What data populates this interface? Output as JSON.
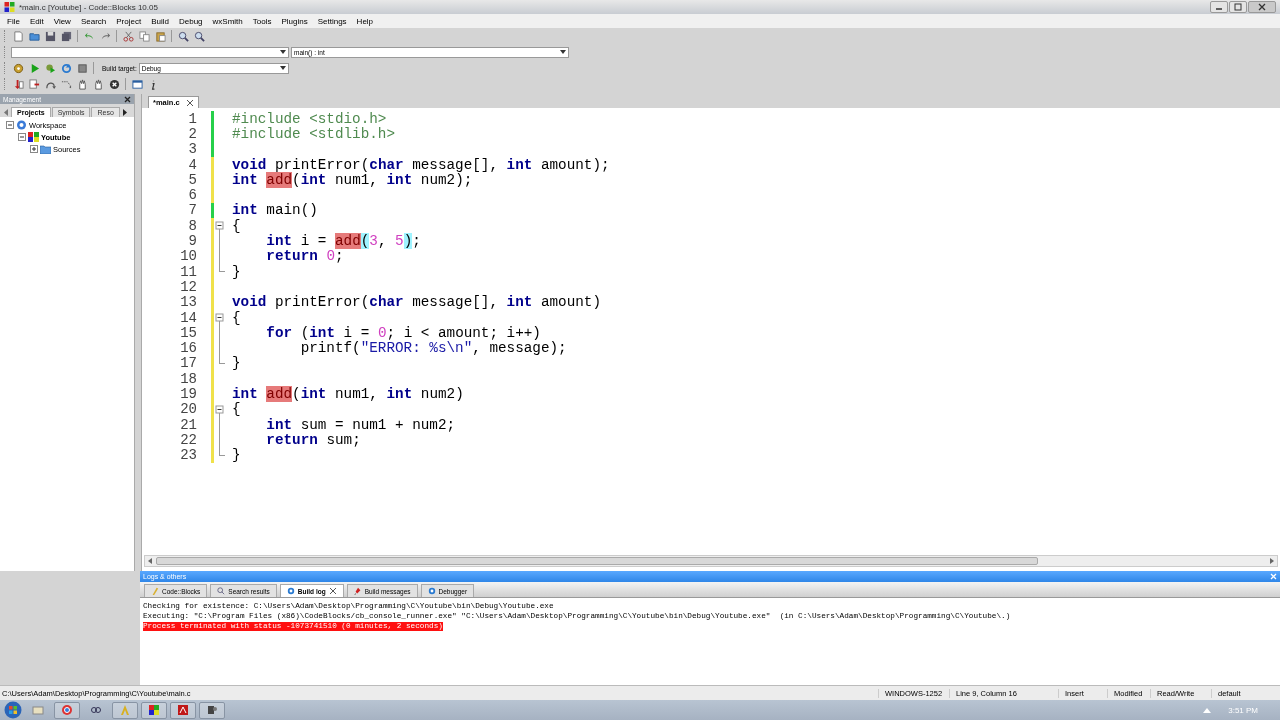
{
  "window": {
    "title": "*main.c [Youtube] - Code::Blocks 10.05"
  },
  "menu": [
    "File",
    "Edit",
    "View",
    "Search",
    "Project",
    "Build",
    "Debug",
    "wxSmith",
    "Tools",
    "Plugins",
    "Settings",
    "Help"
  ],
  "toolbar": {
    "scope_value": "main() : int",
    "build_target_label": "Build target:",
    "build_target": "Debug"
  },
  "management": {
    "title": "Management",
    "tabs": [
      {
        "label": "Projects",
        "selected": true
      },
      {
        "label": "Symbols",
        "selected": false
      },
      {
        "label": "Reso",
        "selected": false
      }
    ],
    "tree": [
      {
        "label": "Workspace",
        "kind": "workspace",
        "expanded": true,
        "active": false,
        "children": [
          {
            "label": "Youtube",
            "kind": "project",
            "expanded": true,
            "active": true,
            "children": [
              {
                "label": "Sources",
                "kind": "folder",
                "expanded": false,
                "active": false
              }
            ]
          }
        ]
      }
    ]
  },
  "editor": {
    "tabs": [
      {
        "label": "*main.c",
        "selected": true
      }
    ],
    "lines": [
      {
        "number": "1",
        "modified": false,
        "tokens": [
          {
            "kind": "pp",
            "text": "#include <stdio.h>"
          }
        ]
      },
      {
        "number": "2",
        "modified": false,
        "tokens": [
          {
            "kind": "pp",
            "text": "#include <stdlib.h>"
          }
        ]
      },
      {
        "number": "3",
        "modified": false
      },
      {
        "number": "4",
        "modified": true,
        "tokens": [
          {
            "kind": "kw",
            "text": "void"
          },
          {
            "kind": "op",
            "text": " printError("
          },
          {
            "kind": "kw",
            "text": "char"
          },
          {
            "kind": "op",
            "text": " message[], "
          },
          {
            "kind": "kw",
            "text": "int"
          },
          {
            "kind": "op",
            "text": " amount);"
          }
        ]
      },
      {
        "number": "5",
        "modified": true,
        "tokens": [
          {
            "kind": "kw",
            "text": "int "
          },
          {
            "kind": "hl",
            "text": "add"
          },
          {
            "kind": "op",
            "text": "("
          },
          {
            "kind": "kw",
            "text": "int"
          },
          {
            "kind": "op",
            "text": " num1, "
          },
          {
            "kind": "kw",
            "text": "int"
          },
          {
            "kind": "op",
            "text": " num2);"
          }
        ]
      },
      {
        "number": "6",
        "modified": true
      },
      {
        "number": "7",
        "modified": false,
        "tokens": [
          {
            "kind": "kw",
            "text": "int"
          },
          {
            "kind": "op",
            "text": " main()"
          }
        ]
      },
      {
        "number": "8",
        "modified": true,
        "kind": "foldstart",
        "tokens": [
          {
            "kind": "op",
            "text": "{"
          }
        ]
      },
      {
        "number": "9",
        "modified": true,
        "kind": "foldbody",
        "tokens": [
          {
            "kind": "kw",
            "text": "    int"
          },
          {
            "kind": "op",
            "text": " i = "
          },
          {
            "kind": "hl",
            "text": "add"
          },
          {
            "kind": "brace",
            "text": "("
          },
          {
            "kind": "num",
            "text": "3"
          },
          {
            "kind": "op",
            "text": ", "
          },
          {
            "kind": "num",
            "text": "5"
          },
          {
            "kind": "brace",
            "text": ")"
          },
          {
            "kind": "op",
            "text": ";"
          }
        ]
      },
      {
        "number": "10",
        "modified": true,
        "kind": "foldbody",
        "tokens": [
          {
            "kind": "kw",
            "text": "    return "
          },
          {
            "kind": "num",
            "text": "0"
          },
          {
            "kind": "op",
            "text": ";"
          }
        ]
      },
      {
        "number": "11",
        "modified": true,
        "kind": "foldend",
        "tokens": [
          {
            "kind": "op",
            "text": "}"
          }
        ]
      },
      {
        "number": "12",
        "modified": true
      },
      {
        "number": "13",
        "modified": true,
        "tokens": [
          {
            "kind": "kw",
            "text": "void"
          },
          {
            "kind": "op",
            "text": " printError("
          },
          {
            "kind": "kw",
            "text": "char"
          },
          {
            "kind": "op",
            "text": " message[], "
          },
          {
            "kind": "kw",
            "text": "int"
          },
          {
            "kind": "op",
            "text": " amount)"
          }
        ]
      },
      {
        "number": "14",
        "modified": true,
        "kind": "foldstart",
        "tokens": [
          {
            "kind": "op",
            "text": "{"
          }
        ]
      },
      {
        "number": "15",
        "modified": true,
        "kind": "foldbody",
        "tokens": [
          {
            "kind": "kw",
            "text": "    for"
          },
          {
            "kind": "op",
            "text": " ("
          },
          {
            "kind": "kw",
            "text": "int"
          },
          {
            "kind": "op",
            "text": " i = "
          },
          {
            "kind": "num",
            "text": "0"
          },
          {
            "kind": "op",
            "text": "; i < amount; i++)"
          }
        ]
      },
      {
        "number": "16",
        "modified": true,
        "kind": "foldbody",
        "tokens": [
          {
            "kind": "op",
            "text": "        printf("
          },
          {
            "kind": "str",
            "text": "\"ERROR: %s\\n\""
          },
          {
            "kind": "op",
            "text": ", message);"
          }
        ]
      },
      {
        "number": "17",
        "modified": true,
        "kind": "foldend",
        "tokens": [
          {
            "kind": "op",
            "text": "}"
          }
        ]
      },
      {
        "number": "18",
        "modified": true
      },
      {
        "number": "19",
        "modified": true,
        "tokens": [
          {
            "kind": "kw",
            "text": "int "
          },
          {
            "kind": "hl",
            "text": "add"
          },
          {
            "kind": "op",
            "text": "("
          },
          {
            "kind": "kw",
            "text": "int"
          },
          {
            "kind": "op",
            "text": " num1, "
          },
          {
            "kind": "kw",
            "text": "int"
          },
          {
            "kind": "op",
            "text": " num2)"
          }
        ]
      },
      {
        "number": "20",
        "modified": true,
        "kind": "foldstart",
        "tokens": [
          {
            "kind": "op",
            "text": "{"
          }
        ]
      },
      {
        "number": "21",
        "modified": true,
        "kind": "foldbody",
        "tokens": [
          {
            "kind": "kw",
            "text": "    int"
          },
          {
            "kind": "op",
            "text": " sum = num1 + num2;"
          }
        ]
      },
      {
        "number": "22",
        "modified": true,
        "kind": "foldbody",
        "tokens": [
          {
            "kind": "kw",
            "text": "    return"
          },
          {
            "kind": "op",
            "text": " sum;"
          }
        ]
      },
      {
        "number": "23",
        "modified": true,
        "kind": "foldend",
        "tokens": [
          {
            "kind": "op",
            "text": "}"
          }
        ]
      }
    ]
  },
  "logs": {
    "title": "Logs & others",
    "tabs": [
      {
        "label": "Code::Blocks",
        "selected": false,
        "closable": false
      },
      {
        "label": "Search results",
        "selected": false,
        "closable": false
      },
      {
        "label": "Build log",
        "selected": true,
        "closable": true
      },
      {
        "label": "Build messages",
        "selected": false,
        "closable": false
      },
      {
        "label": "Debugger",
        "selected": false,
        "closable": false
      }
    ],
    "lines": [
      {
        "text": "Checking for existence: C:\\Users\\Adam\\Desktop\\Programming\\C\\Youtube\\bin\\Debug\\Youtube.exe",
        "error": false
      },
      {
        "text": "Executing: \"C:\\Program Files (x86)\\CodeBlocks/cb_console_runner.exe\" \"C:\\Users\\Adam\\Desktop\\Programming\\C\\Youtube\\bin\\Debug\\Youtube.exe\"  (in C:\\Users\\Adam\\Desktop\\Programming\\C\\Youtube\\.)",
        "error": false
      },
      {
        "text": "Process terminated with status -1073741510 (0 minutes, 2 seconds)",
        "error": true
      }
    ]
  },
  "status_bar": {
    "path": "C:\\Users\\Adam\\Desktop\\Programming\\C\\Youtube\\main.c",
    "fields": [
      "WINDOWS-1252",
      "Line 9, Column 16",
      "Insert",
      "Modified",
      "Read/Write",
      "default"
    ]
  },
  "taskbar": {
    "clock": "3:51 PM"
  }
}
